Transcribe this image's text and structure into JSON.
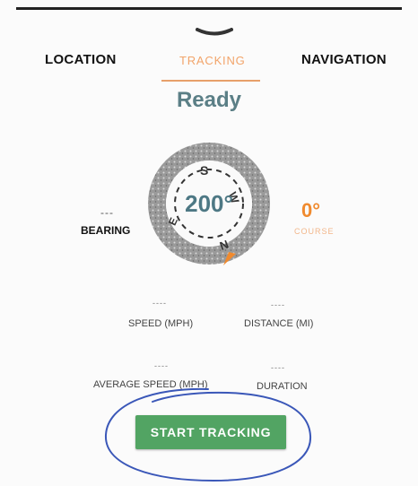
{
  "tabs": {
    "location": "LOCATION",
    "tracking": "TRACKING",
    "navigation": "NAVIGATION",
    "active": "TRACKING"
  },
  "status": "Ready",
  "compass": {
    "heading": "200°",
    "letters": {
      "north": "N",
      "east": "E",
      "south": "S",
      "west": "W"
    }
  },
  "bearing": {
    "value": "---",
    "label": "BEARING"
  },
  "course": {
    "value": "0°",
    "label": "COURSE"
  },
  "stats": {
    "speed": {
      "value": "----",
      "label": "SPEED (MPH)"
    },
    "distance": {
      "value": "----",
      "label": "DISTANCE (MI)"
    },
    "average_speed": {
      "value": "----",
      "label": "AVERAGE SPEED (MPH)"
    },
    "duration": {
      "value": "----",
      "label": "DURATION"
    }
  },
  "button": {
    "start": "START TRACKING"
  },
  "colors": {
    "accent": "#f08a2e",
    "status": "#5b7f86",
    "button": "#52a463",
    "annotation": "#3a57b8"
  }
}
